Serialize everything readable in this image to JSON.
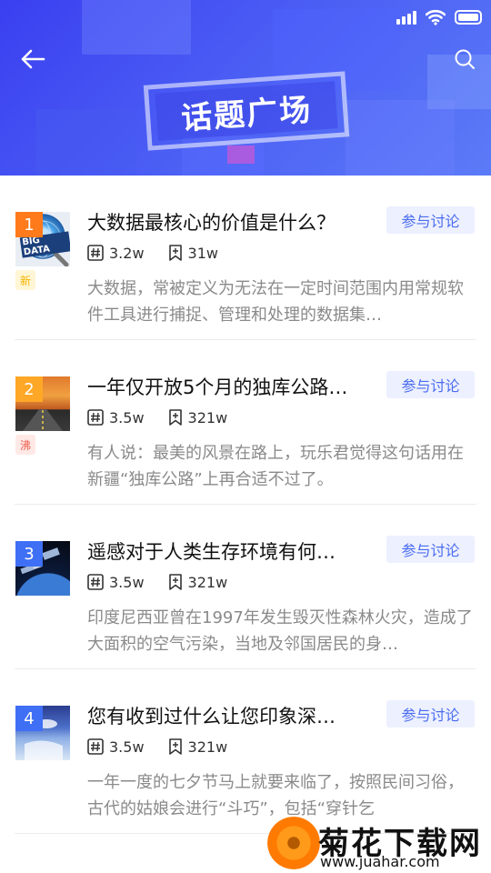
{
  "header": {
    "title": "话题广场"
  },
  "colors": {
    "accent": "#4a6cf0",
    "banner": "#4350f2",
    "button_bg": "#edf0ff",
    "rank_1": "#ff7a1a",
    "rank_2": "#ffa726",
    "rank_other": "#3e6ff5",
    "tag_new": "#f5b400",
    "tag_hot": "#f05a4a"
  },
  "topics": [
    {
      "rank": "1",
      "title": "大数据最核心的价值是什么？",
      "join_label": "参与讨论",
      "comments": "3.2w",
      "bookmarks": "31w",
      "tag": "新",
      "description": "大数据，常被定义为无法在一定时间范围内用常规软件工具进行捕捉、管理和处理的数据集…",
      "thumb_label": "BIG DATA"
    },
    {
      "rank": "2",
      "title": "一年仅开放5个月的独库公路…",
      "join_label": "参与讨论",
      "comments": "3.5w",
      "bookmarks": "321w",
      "tag": "沸",
      "description": "有人说：最美的风景在路上，玩乐君觉得这句话用在新疆“独库公路”上再合适不过了。"
    },
    {
      "rank": "3",
      "title": "遥感对于人类生存环境有何…",
      "join_label": "参与讨论",
      "comments": "3.5w",
      "bookmarks": "321w",
      "description": "印度尼西亚曾在1997年发生毁灭性森林火灾，造成了大面积的空气污染，当地及邻国居民的身…"
    },
    {
      "rank": "4",
      "title": "您有收到过什么让您印象深…",
      "join_label": "参与讨论",
      "comments": "3.5w",
      "bookmarks": "321w",
      "description": "一年一度的七夕节马上就要来临了，按照民间习俗，古代的姑娘会进行“斗巧”，包括“穿针乞"
    }
  ],
  "watermark": {
    "name": "菊花下载网",
    "url": "www.juahar.com"
  }
}
